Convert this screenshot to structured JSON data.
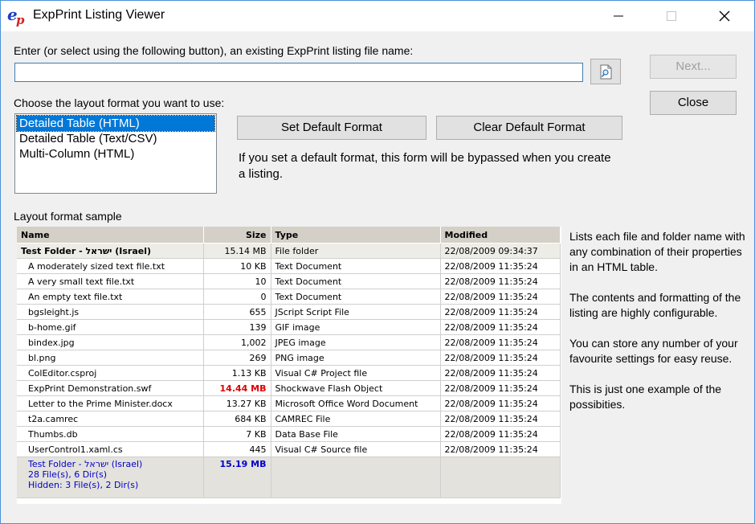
{
  "window": {
    "title": "ExpPrint Listing Viewer",
    "logo_text": "ep"
  },
  "file_prompt": "Enter (or select using the following button), an existing ExpPrint listing file name:",
  "file_input": {
    "value": ""
  },
  "buttons": {
    "next": "Next...",
    "close": "Close",
    "set_default": "Set Default Format",
    "clear_default": "Clear Default Format"
  },
  "layout_prompt": "Choose the layout format you want to use:",
  "formats": [
    "Detailed Table (HTML)",
    "Detailed Table (Text/CSV)",
    "Multi-Column (HTML)"
  ],
  "default_note": "If you set a default format, this form will be bypassed when you create a listing.",
  "sample_label": "Layout format sample",
  "table": {
    "headers": [
      "Name",
      "Size",
      "Type",
      "Modified"
    ],
    "folder": {
      "name": "Test Folder - ישראל (Israel)",
      "size": "15.14 MB",
      "type": "File folder",
      "modified": "22/08/2009 09:34:37"
    },
    "rows": [
      {
        "name": "A moderately sized text file.txt",
        "size": "10 KB",
        "type": "Text Document",
        "modified": "22/08/2009 11:35:24"
      },
      {
        "name": "A very small text file.txt",
        "size": "10",
        "type": "Text Document",
        "modified": "22/08/2009 11:35:24"
      },
      {
        "name": "An empty text file.txt",
        "size": "0",
        "type": "Text Document",
        "modified": "22/08/2009 11:35:24"
      },
      {
        "name": "bgsleight.js",
        "size": "655",
        "type": "JScript Script File",
        "modified": "22/08/2009 11:35:24"
      },
      {
        "name": "b-home.gif",
        "size": "139",
        "type": "GIF image",
        "modified": "22/08/2009 11:35:24"
      },
      {
        "name": "bindex.jpg",
        "size": "1,002",
        "type": "JPEG image",
        "modified": "22/08/2009 11:35:24"
      },
      {
        "name": "bl.png",
        "size": "269",
        "type": "PNG image",
        "modified": "22/08/2009 11:35:24"
      },
      {
        "name": "ColEditor.csproj",
        "size": "1.13 KB",
        "type": "Visual C# Project file",
        "modified": "22/08/2009 11:35:24"
      },
      {
        "name": "ExpPrint Demonstration.swf",
        "size": "14.44 MB",
        "type": "Shockwave Flash Object",
        "modified": "22/08/2009 11:35:24"
      },
      {
        "name": "Letter to the Prime Minister.docx",
        "size": "13.27 KB",
        "type": "Microsoft Office Word Document",
        "modified": "22/08/2009 11:35:24"
      },
      {
        "name": "t2a.camrec",
        "size": "684 KB",
        "type": "CAMREC File",
        "modified": "22/08/2009 11:35:24"
      },
      {
        "name": "Thumbs.db",
        "size": "7 KB",
        "type": "Data Base File",
        "modified": "22/08/2009 11:35:24"
      },
      {
        "name": "UserControl1.xaml.cs",
        "size": "445",
        "type": "Visual C# Source file",
        "modified": "22/08/2009 11:35:24"
      }
    ],
    "summary": {
      "lines": [
        "Test Folder - ישראל (Israel)",
        "28 File(s), 6 Dir(s)",
        "Hidden: 3 File(s), 2 Dir(s)"
      ],
      "total": "15.19 MB"
    }
  },
  "description": [
    "Lists each file and folder name with any combination of their properties in an HTML table.",
    "The contents and formatting of the listing are highly configurable.",
    "You can store any number of your favourite settings for easy reuse.",
    "This is just one example of the possibities."
  ],
  "colors": {
    "selection": "#0078d7",
    "highlight_size": "#e00000",
    "summary_text": "#0000cc",
    "header_bg": "#d4d0c8"
  },
  "icons": {
    "browse": "browse-file-icon",
    "minimize": "minimize-icon",
    "maximize": "maximize-icon",
    "close": "close-icon"
  }
}
